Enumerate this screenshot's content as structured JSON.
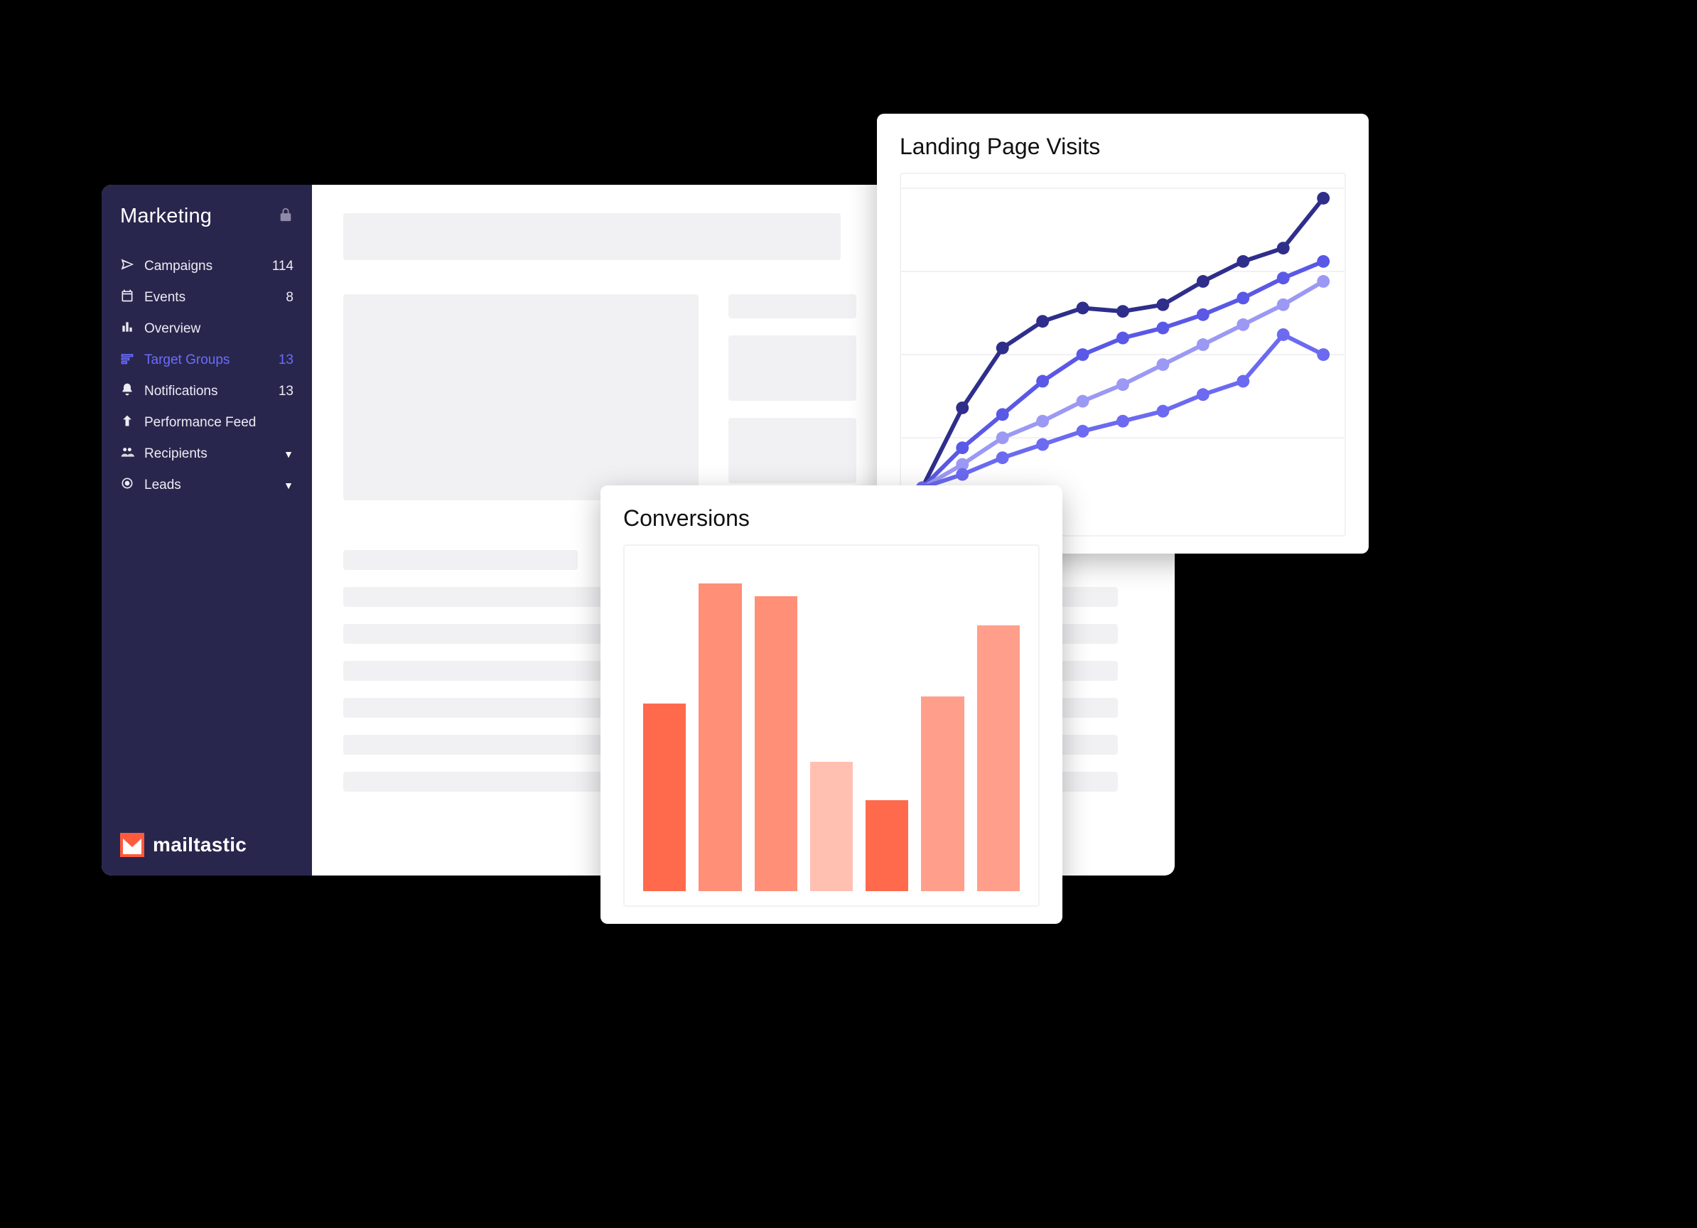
{
  "sidebar": {
    "title": "Marketing",
    "items": [
      {
        "icon": "paper-plane-icon",
        "label": "Campaigns",
        "count": "114"
      },
      {
        "icon": "calendar-icon",
        "label": "Events",
        "count": "8"
      },
      {
        "icon": "bars-icon",
        "label": "Overview"
      },
      {
        "icon": "target-icon",
        "label": "Target Groups",
        "count": "13",
        "active": true
      },
      {
        "icon": "bell-icon",
        "label": "Notifications",
        "count": "13"
      },
      {
        "icon": "arrow-up-icon",
        "label": "Performance Feed"
      },
      {
        "icon": "people-icon",
        "label": "Recipients",
        "expandable": true
      },
      {
        "icon": "target2-icon",
        "label": "Leads",
        "expandable": true
      }
    ]
  },
  "brand": {
    "name": "mailtastic"
  },
  "cards": {
    "line": {
      "title": "Landing Page Visits"
    },
    "bar": {
      "title": "Conversions"
    }
  },
  "chart_data": [
    {
      "id": "landing_page_visits",
      "type": "line",
      "title": "Landing Page Visits",
      "x": [
        1,
        2,
        3,
        4,
        5,
        6,
        7,
        8,
        9,
        10,
        11
      ],
      "ylim": [
        0,
        100
      ],
      "gridlines_y": [
        25,
        50,
        75,
        100
      ],
      "series": [
        {
          "name": "series-a",
          "color": "#2f2e8b",
          "values": [
            10,
            34,
            52,
            60,
            64,
            63,
            65,
            72,
            78,
            82,
            97
          ]
        },
        {
          "name": "series-b",
          "color": "#5a58e6",
          "values": [
            10,
            22,
            32,
            42,
            50,
            55,
            58,
            62,
            67,
            73,
            78
          ]
        },
        {
          "name": "series-c",
          "color": "#9b99f4",
          "values": [
            10,
            17,
            25,
            30,
            36,
            41,
            47,
            53,
            59,
            65,
            72
          ]
        },
        {
          "name": "series-d",
          "color": "#6b6af0",
          "values": [
            10,
            14,
            19,
            23,
            27,
            30,
            33,
            38,
            42,
            56,
            50
          ]
        }
      ]
    },
    {
      "id": "conversions",
      "type": "bar",
      "title": "Conversions",
      "categories": [
        "1",
        "2",
        "3",
        "4",
        "5",
        "6",
        "7"
      ],
      "ylim": [
        0,
        100
      ],
      "series": [
        {
          "name": "value",
          "values": [
            58,
            95,
            91,
            40,
            28,
            60,
            82
          ]
        }
      ],
      "bar_colors": [
        "#ff6a4d",
        "#ff8f77",
        "#ff8f77",
        "#ffc0b2",
        "#ff6a4d",
        "#ff9f8b",
        "#ff9f8b"
      ]
    }
  ]
}
